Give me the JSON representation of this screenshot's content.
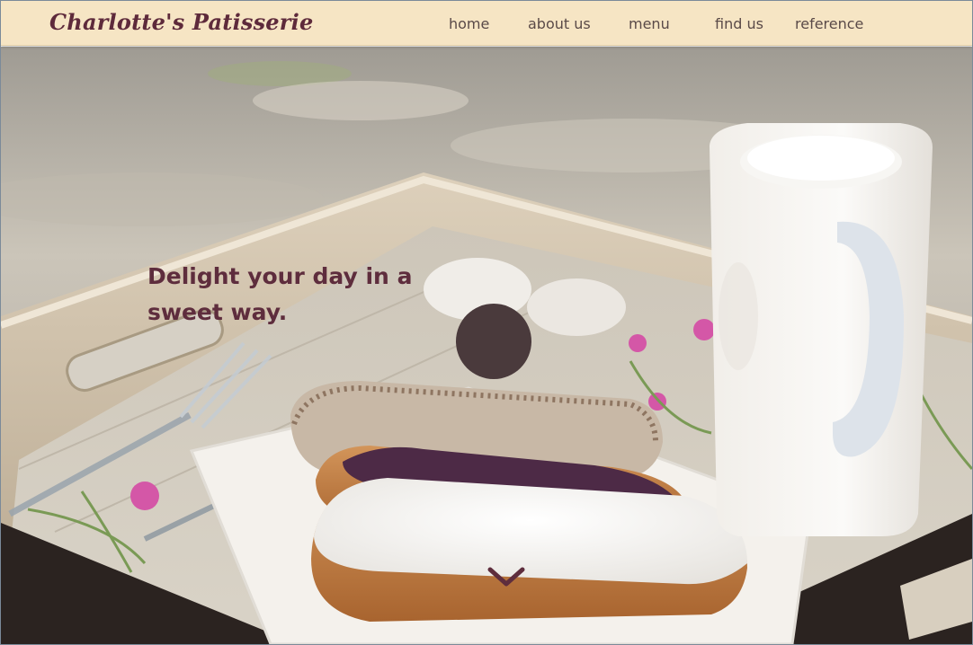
{
  "brand": {
    "name": "Charlotte's Patisserie"
  },
  "nav": {
    "items": [
      {
        "label": "home"
      },
      {
        "label": "about us"
      },
      {
        "label": "menu"
      },
      {
        "label": "find us"
      },
      {
        "label": "reference"
      }
    ]
  },
  "hero": {
    "heading_line1": "Delight your day in a",
    "heading_line2": "sweet way.",
    "scroll_icon": "chevron-down-icon"
  },
  "colors": {
    "header_bg": "#f6e5c4",
    "brand_text": "#5e2a3b",
    "nav_text": "#5a4a48",
    "heading_text": "#5e2d3d",
    "accent": "#5e2d3d"
  }
}
